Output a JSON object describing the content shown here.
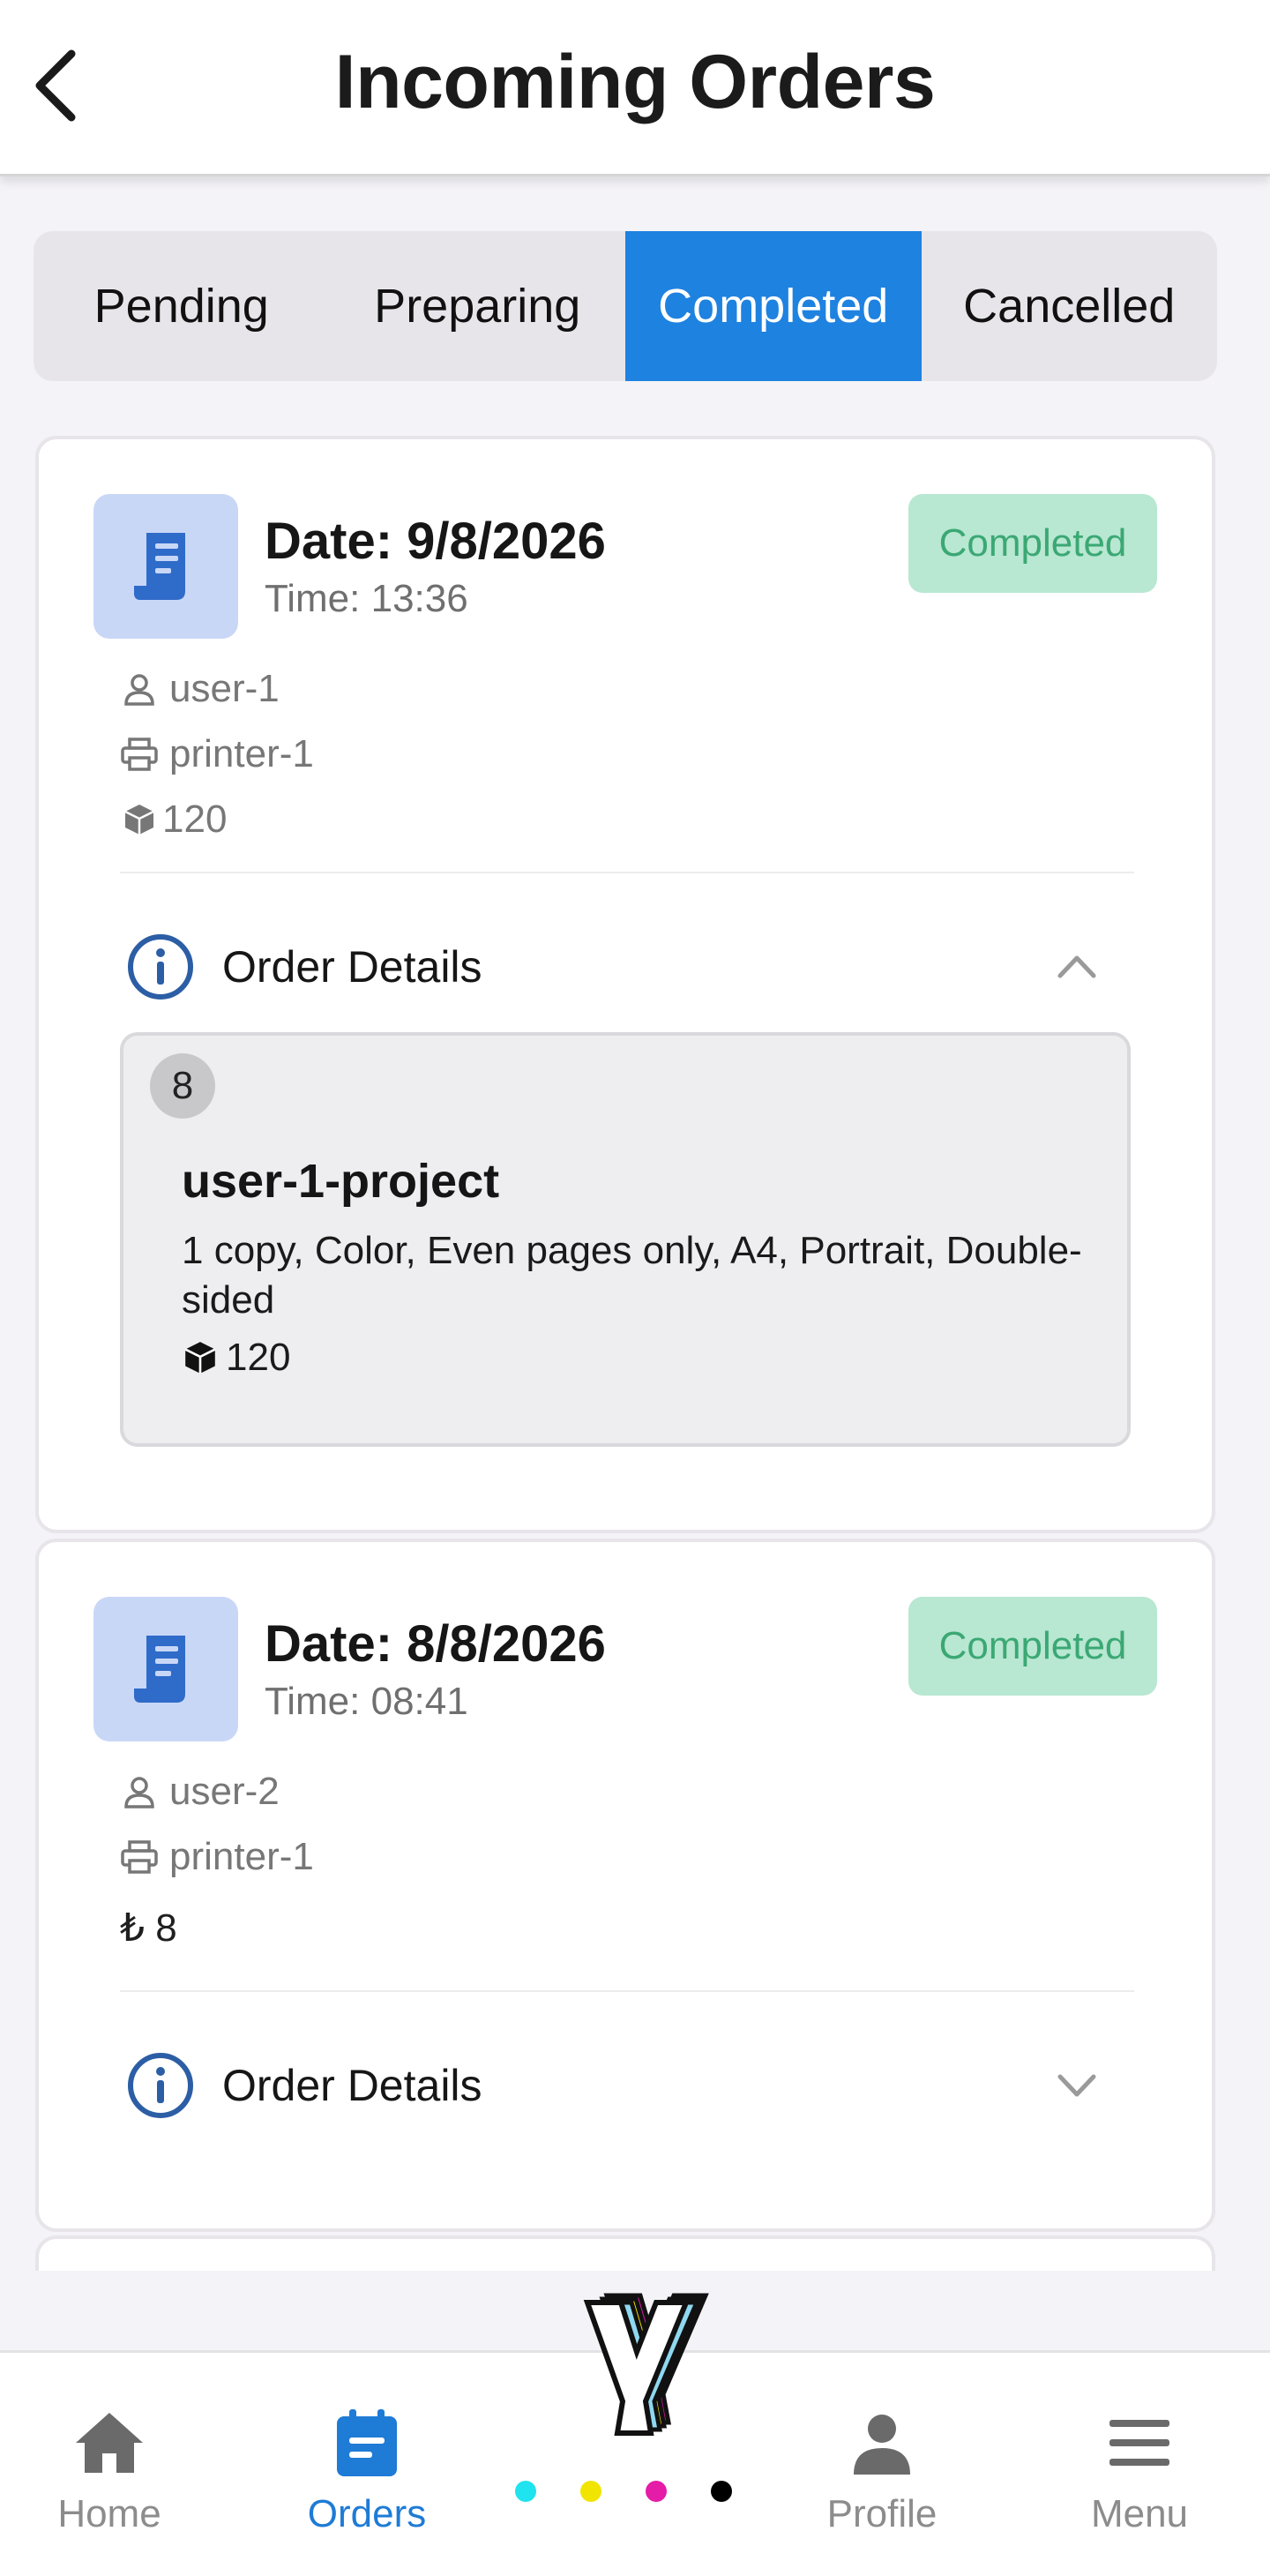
{
  "header": {
    "title": "Incoming Orders",
    "back_icon": "chevron-left-icon"
  },
  "tabs": [
    {
      "label": "Pending",
      "active": false
    },
    {
      "label": "Preparing",
      "active": false
    },
    {
      "label": "Completed",
      "active": true
    },
    {
      "label": "Cancelled",
      "active": false
    }
  ],
  "orders": [
    {
      "date": "Date: 9/8/2026",
      "time": "Time: 13:36",
      "status": "Completed",
      "user": "user-1",
      "printer": "printer-1",
      "amount": "120",
      "amount_icon": "cube-icon",
      "details_label": "Order Details",
      "details_expanded": true,
      "items": [
        {
          "qty": "8",
          "title": "user-1-project",
          "description": "1 copy, Color, Even pages only, A4, Portrait, Double-sided",
          "price": "120"
        }
      ]
    },
    {
      "date": "Date: 8/8/2026",
      "time": "Time: 08:41",
      "status": "Completed",
      "user": "user-2",
      "printer": "printer-1",
      "amount": "₺ 8",
      "amount_icon": "lira-icon",
      "details_label": "Order Details",
      "details_expanded": false
    }
  ],
  "nav": [
    {
      "label": "Home",
      "icon": "home-icon",
      "active": false
    },
    {
      "label": "Orders",
      "icon": "orders-icon",
      "active": true
    },
    {
      "label": "Profile",
      "icon": "profile-icon",
      "active": false
    },
    {
      "label": "Menu",
      "icon": "menu-icon",
      "active": false
    }
  ],
  "brand": {
    "logo_letter": "y",
    "dots": [
      "#1fe3ef",
      "#f1e500",
      "#e51ca8",
      "#000000"
    ]
  },
  "colors": {
    "accent": "#1e82e0",
    "status_bg": "#b8e7d2",
    "status_text": "#3ba874",
    "icon_bg": "#c9d7f7"
  }
}
